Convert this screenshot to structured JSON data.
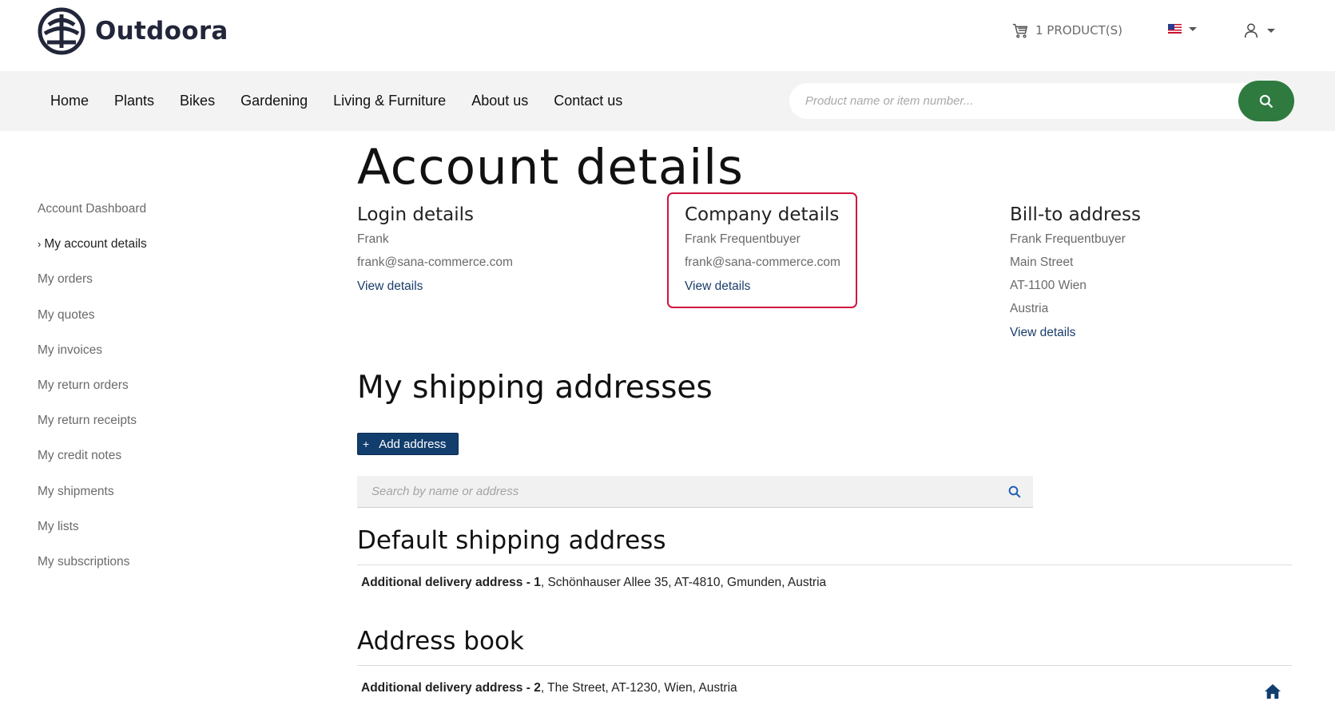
{
  "header": {
    "brand": "Outdoora",
    "cart_label": "1 PRODUCT(S)",
    "language_icon": "us-flag-icon",
    "user_icon": "user-icon"
  },
  "nav": {
    "items": [
      "Home",
      "Plants",
      "Bikes",
      "Gardening",
      "Living & Furniture",
      "About us",
      "Contact us"
    ],
    "search_placeholder": "Product name or item number..."
  },
  "sidebar": {
    "items": [
      {
        "label": "Account Dashboard",
        "active": false
      },
      {
        "label": "My account details",
        "active": true
      },
      {
        "label": "My orders",
        "active": false
      },
      {
        "label": "My quotes",
        "active": false
      },
      {
        "label": "My invoices",
        "active": false
      },
      {
        "label": "My return orders",
        "active": false
      },
      {
        "label": "My return receipts",
        "active": false
      },
      {
        "label": "My credit notes",
        "active": false
      },
      {
        "label": "My shipments",
        "active": false
      },
      {
        "label": "My lists",
        "active": false
      },
      {
        "label": "My subscriptions",
        "active": false
      }
    ],
    "active_marker": "›"
  },
  "main": {
    "title": "Account details",
    "login": {
      "heading": "Login details",
      "name": "Frank",
      "email": "frank@sana-commerce.com",
      "link": "View details"
    },
    "company": {
      "heading": "Company details",
      "name": "Frank Frequentbuyer",
      "email": "frank@sana-commerce.com",
      "link": "View details"
    },
    "bill_to": {
      "heading": "Bill-to address",
      "name": "Frank Frequentbuyer",
      "street": "Main Street",
      "city": "AT-1100 Wien",
      "country": "Austria",
      "link": "View details"
    },
    "shipping": {
      "heading": "My shipping addresses",
      "add_button": "Add address",
      "add_button_icon": "+",
      "search_placeholder": "Search by name or address",
      "default_heading": "Default shipping address",
      "default_address": {
        "name": "Additional delivery address - 1",
        "details": ", Schönhauser Allee 35, AT-4810, Gmunden, Austria"
      },
      "book_heading": "Address book",
      "book_addresses": [
        {
          "name": "Additional delivery address - 2",
          "details": ", The Street, AT-1230, Wien, Austria"
        }
      ]
    }
  },
  "colors": {
    "brand_dark": "#22263a",
    "search_button": "#2f7a3f",
    "primary_button": "#123e6e",
    "link": "#1a3d6b",
    "highlight_border": "#d0133f"
  }
}
